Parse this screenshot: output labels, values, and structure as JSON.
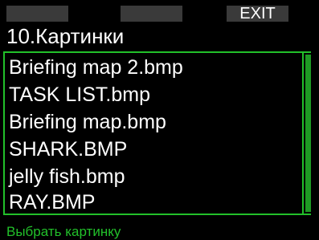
{
  "softkeys": {
    "left_label": "",
    "middle_label": "",
    "right_label": "EXIT"
  },
  "header": {
    "title": "10.Картинки"
  },
  "file_list": {
    "items": [
      "Briefing map 2.bmp",
      "TASK LIST.bmp",
      "Briefing map.bmp",
      "SHARK.BMP",
      "jelly fish.bmp",
      "RAY.BMP"
    ],
    "selected_index": 0
  },
  "status_bar": {
    "hint": "Выбрать картинку"
  },
  "colors": {
    "background": "#000000",
    "accent": "#22c02a",
    "softkey": "#3a3a3a",
    "text": "#ffffff"
  }
}
